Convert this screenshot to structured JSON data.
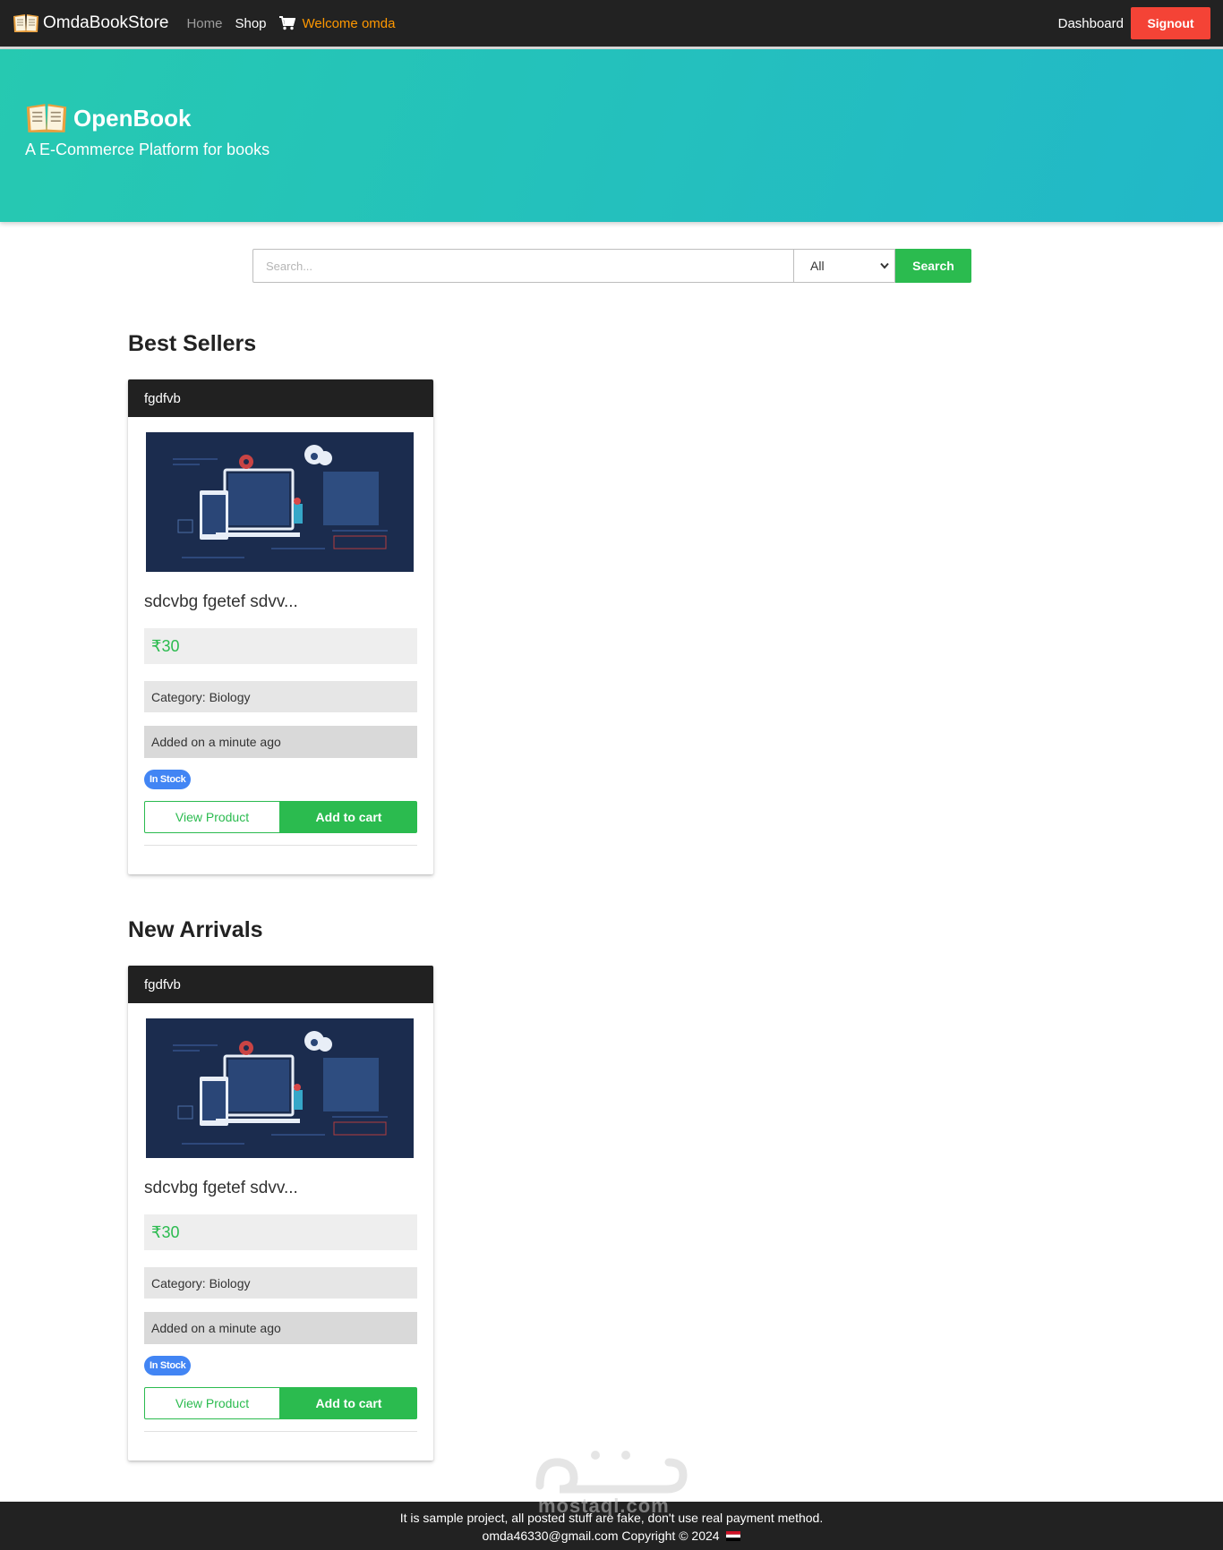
{
  "navbar": {
    "brand": "OmdaBookStore",
    "home": "Home",
    "shop": "Shop",
    "welcome": "Welcome omda",
    "dashboard": "Dashboard",
    "signout": "Signout"
  },
  "hero": {
    "title": "OpenBook",
    "subtitle": "A E-Commerce Platform for books"
  },
  "search": {
    "placeholder": "Search...",
    "category_selected": "All",
    "button": "Search"
  },
  "sections": {
    "best_sellers": {
      "title": "Best Sellers",
      "card": {
        "header": "fgdfvb",
        "title": "sdcvbg fgetef sdvv...",
        "price": "₹30",
        "category": "Category: Biology",
        "added": "Added on a minute ago",
        "badge": "In Stock",
        "view": "View Product",
        "add": "Add to cart"
      }
    },
    "new_arrivals": {
      "title": "New Arrivals",
      "card": {
        "header": "fgdfvb",
        "title": "sdcvbg fgetef sdvv...",
        "price": "₹30",
        "category": "Category: Biology",
        "added": "Added on a minute ago",
        "badge": "In Stock",
        "view": "View Product",
        "add": "Add to cart"
      }
    }
  },
  "footer": {
    "line1": "It is sample project, all posted stuff are fake, don't use real payment method.",
    "line2": "omda46330@gmail.com Copyright © 2024"
  },
  "watermark": {
    "text": "mostaql.com"
  },
  "colors": {
    "navbar": "#222222",
    "accent_green": "#2bbb4f",
    "signout_red": "#f44336",
    "welcome_orange": "#ff9800",
    "badge_blue": "#4285f4",
    "hero_gradient_start": "#26c9b1",
    "hero_gradient_end": "#22b8c8"
  },
  "icons": {
    "brand": "open-book-icon",
    "cart": "cart-icon",
    "flag": "egypt-flag-icon"
  }
}
